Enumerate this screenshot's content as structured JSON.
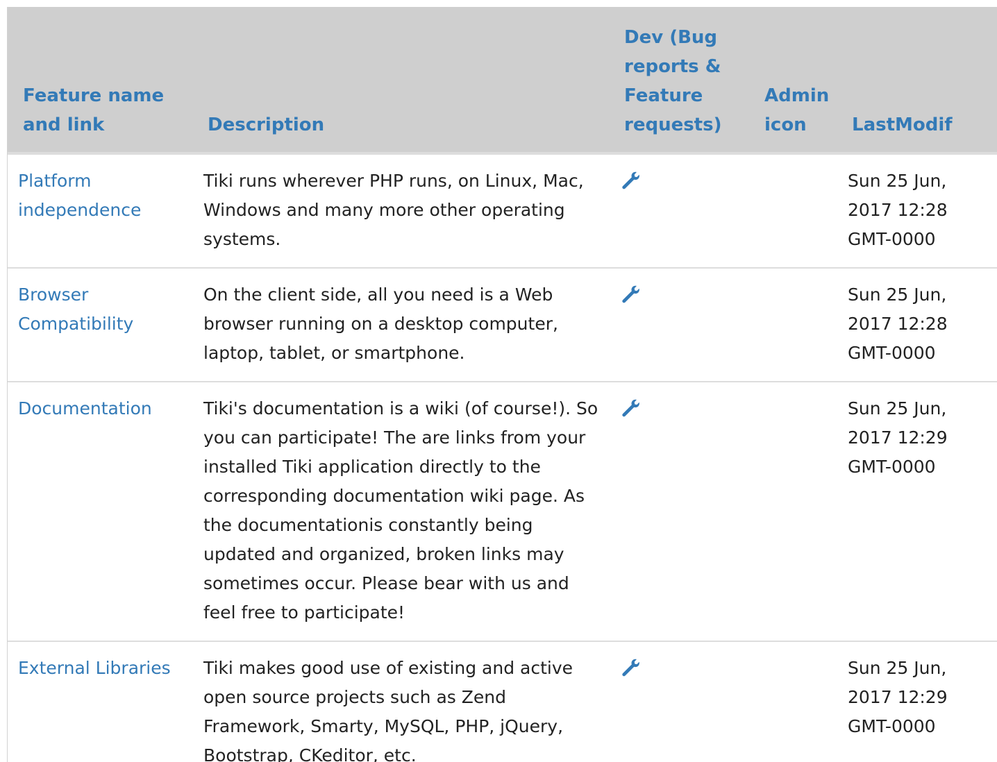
{
  "table": {
    "headers": {
      "name": "Feature name and link",
      "description": "Description",
      "dev": "Dev (Bug reports & Feature requests)",
      "admin": "Admin icon",
      "lastmodif": "LastModif"
    },
    "rows": [
      {
        "name": "Platform independence",
        "description": "Tiki runs wherever PHP runs, on Linux, Mac, Windows and many more other operating systems.",
        "dev_icon": "wrench-icon",
        "lastmodif": "Sun 25 Jun, 2017 12:28 GMT-0000"
      },
      {
        "name": "Browser Compatibility",
        "description": "On the client side, all you need is a Web browser running on a desktop computer, laptop, tablet, or smartphone.",
        "dev_icon": "wrench-icon",
        "lastmodif": "Sun 25 Jun, 2017 12:28 GMT-0000"
      },
      {
        "name": "Documentation",
        "description": "Tiki's documentation is a wiki (of course!). So you can participate! The are links from your installed Tiki application directly to the corresponding documentation wiki page. As the documentationis constantly being updated and organized, broken links may sometimes occur. Please bear with us and feel free to participate!",
        "dev_icon": "wrench-icon",
        "lastmodif": "Sun 25 Jun, 2017 12:29 GMT-0000"
      },
      {
        "name": "External Libraries",
        "description": "Tiki makes good use of existing and active open source projects such as Zend Framework, Smarty, MySQL, PHP, jQuery, Bootstrap, CKeditor, etc.",
        "dev_icon": "wrench-icon",
        "lastmodif": "Sun 25 Jun, 2017 12:29 GMT-0000"
      }
    ]
  },
  "colors": {
    "link": "#337ab7",
    "header_bg": "#cfcfcf",
    "border": "#dddddd",
    "text": "#222222"
  }
}
